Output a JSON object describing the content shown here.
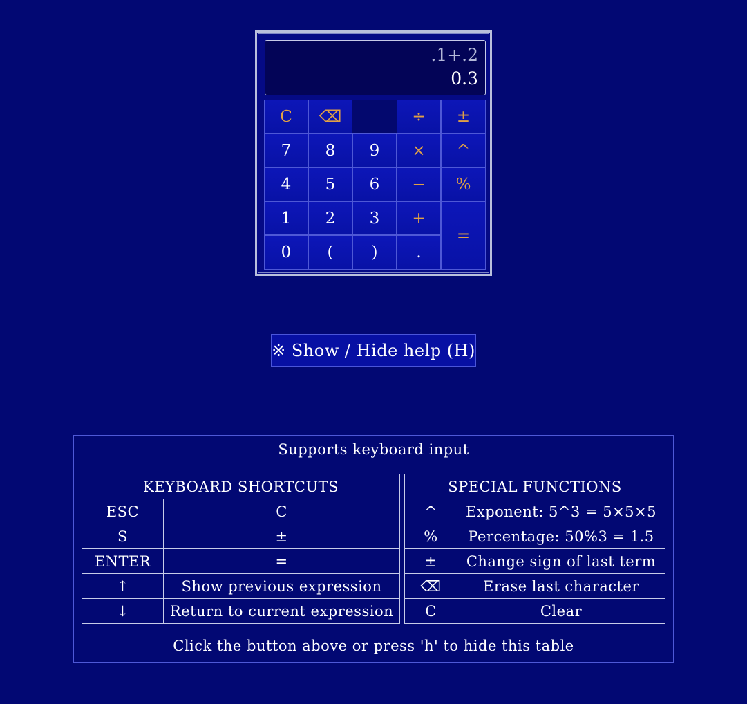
{
  "calculator": {
    "expression": ".1+.2",
    "result": "0.3",
    "keys": [
      {
        "label": "C",
        "kind": "op"
      },
      {
        "label": "⌫",
        "kind": "op"
      },
      {
        "label": "",
        "kind": "blank"
      },
      {
        "label": "÷",
        "kind": "op"
      },
      {
        "label": "±",
        "kind": "op"
      },
      {
        "label": "7",
        "kind": "num"
      },
      {
        "label": "8",
        "kind": "num"
      },
      {
        "label": "9",
        "kind": "num"
      },
      {
        "label": "×",
        "kind": "op"
      },
      {
        "label": "^",
        "kind": "op"
      },
      {
        "label": "4",
        "kind": "num"
      },
      {
        "label": "5",
        "kind": "num"
      },
      {
        "label": "6",
        "kind": "num"
      },
      {
        "label": "−",
        "kind": "op"
      },
      {
        "label": "%",
        "kind": "op"
      },
      {
        "label": "1",
        "kind": "num"
      },
      {
        "label": "2",
        "kind": "num"
      },
      {
        "label": "3",
        "kind": "num"
      },
      {
        "label": "+",
        "kind": "op"
      },
      {
        "label": "=",
        "kind": "op"
      },
      {
        "label": "0",
        "kind": "num"
      },
      {
        "label": "(",
        "kind": "num"
      },
      {
        "label": ")",
        "kind": "num"
      },
      {
        "label": ".",
        "kind": "num"
      }
    ]
  },
  "help_toggle": {
    "icon": "※",
    "label": "Show / Hide help (H)"
  },
  "help": {
    "heading": "Supports keyboard input",
    "footer": "Click the button above or press 'h' to hide this table",
    "shortcuts": {
      "title": "KEYBOARD SHORTCUTS",
      "rows": [
        {
          "key": "ESC",
          "action": "C"
        },
        {
          "key": "S",
          "action": "±"
        },
        {
          "key": "ENTER",
          "action": "="
        },
        {
          "key": "↑",
          "action": "Show previous expression"
        },
        {
          "key": "↓",
          "action": "Return to current expression"
        }
      ]
    },
    "functions": {
      "title": "SPECIAL FUNCTIONS",
      "rows": [
        {
          "symbol": "^",
          "desc": "Exponent: 5^3 = 5×5×5"
        },
        {
          "symbol": "%",
          "desc": "Percentage: 50%3 = 1.5"
        },
        {
          "symbol": "±",
          "desc": "Change sign of last term"
        },
        {
          "symbol": "⌫",
          "desc": "Erase last character"
        },
        {
          "symbol": "C",
          "desc": "Clear"
        }
      ]
    }
  },
  "colors": {
    "background": "#020873",
    "key": "#0812a6",
    "operator_text": "#e0a046",
    "display": "#030457",
    "border": "#c7cbe8"
  }
}
